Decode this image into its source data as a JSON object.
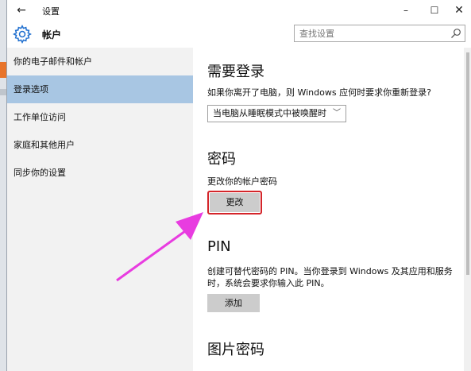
{
  "window": {
    "title": "设置",
    "back_icon": "back-arrow-icon",
    "controls": {
      "minimize": "–",
      "maximize": "☐",
      "close": "✕"
    }
  },
  "header": {
    "title": "帐户",
    "icon": "gear-icon",
    "search": {
      "placeholder": "查找设置",
      "value": ""
    }
  },
  "sidebar": {
    "items": [
      {
        "label": "你的电子邮件和帐户",
        "active": false
      },
      {
        "label": "登录选项",
        "active": true
      },
      {
        "label": "工作单位访问",
        "active": false
      },
      {
        "label": "家庭和其他用户",
        "active": false
      },
      {
        "label": "同步你的设置",
        "active": false
      }
    ]
  },
  "content": {
    "require_signin": {
      "heading": "需要登录",
      "description": "如果你离开了电脑，则 Windows 应何时要求你重新登录?",
      "dropdown_value": "当电脑从睡眠模式中被唤醒时"
    },
    "password": {
      "heading": "密码",
      "description": "更改你的帐户密码",
      "button": "更改"
    },
    "pin": {
      "heading": "PIN",
      "description_line1": "创建可替代密码的 PIN。当你登录到 Windows 及其应用和服务",
      "description_line2": "时，系统会要求你输入此 PIN。",
      "button": "添加"
    },
    "picture_password": {
      "heading": "图片密码"
    }
  },
  "annotation": {
    "highlight_color": "#d4252a",
    "arrow_color": "#e83ce0"
  }
}
